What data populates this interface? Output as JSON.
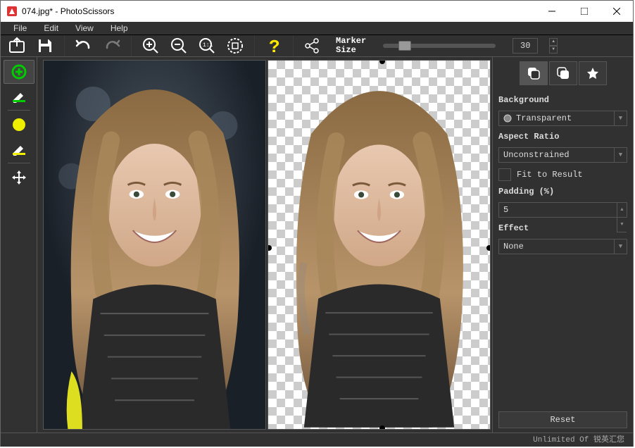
{
  "title": "074.jpg* - PhotoScissors",
  "menu": {
    "file": "File",
    "edit": "Edit",
    "view": "View",
    "help": "Help"
  },
  "toolbar": {
    "marker_label1": "Marker",
    "marker_label2": "Size",
    "marker_value": "30"
  },
  "left_tools": {
    "add_fg": "add-foreground",
    "erase_fg": "erase-foreground",
    "add_bg": "add-background",
    "erase_bg": "erase-background",
    "move": "move-tool"
  },
  "right_panel": {
    "bg_label": "Background",
    "bg_option": "Transparent",
    "aspect_label": "Aspect Ratio",
    "aspect_option": "Unconstrained",
    "fit_label": "Fit to Result",
    "padding_label": "Padding (%)",
    "padding_value": "5",
    "effect_label": "Effect",
    "effect_option": "None",
    "reset": "Reset"
  },
  "status": "Unlimited Of 锐英汇您"
}
